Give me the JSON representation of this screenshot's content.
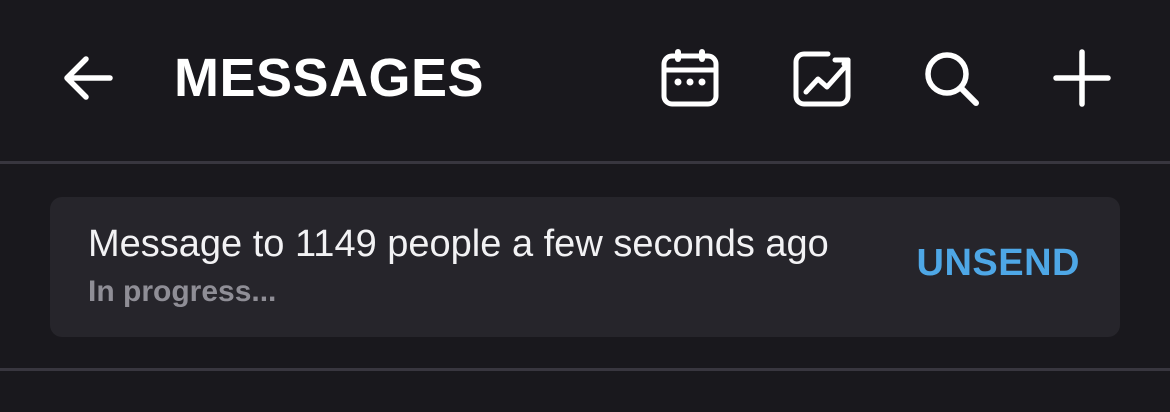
{
  "header": {
    "title": "MESSAGES",
    "icons": [
      "arrow-left-icon",
      "calendar-icon",
      "chart-image-icon",
      "search-icon",
      "plus-icon"
    ]
  },
  "message": {
    "summary": "Message to 1149 people a few seconds ago",
    "status": "In progress...",
    "action_label": "UNSEND"
  },
  "colors": {
    "background": "#19181d",
    "card": "#26252b",
    "divider": "#38363f",
    "accent": "#4ea7e6",
    "status_text": "#8f8e96"
  }
}
